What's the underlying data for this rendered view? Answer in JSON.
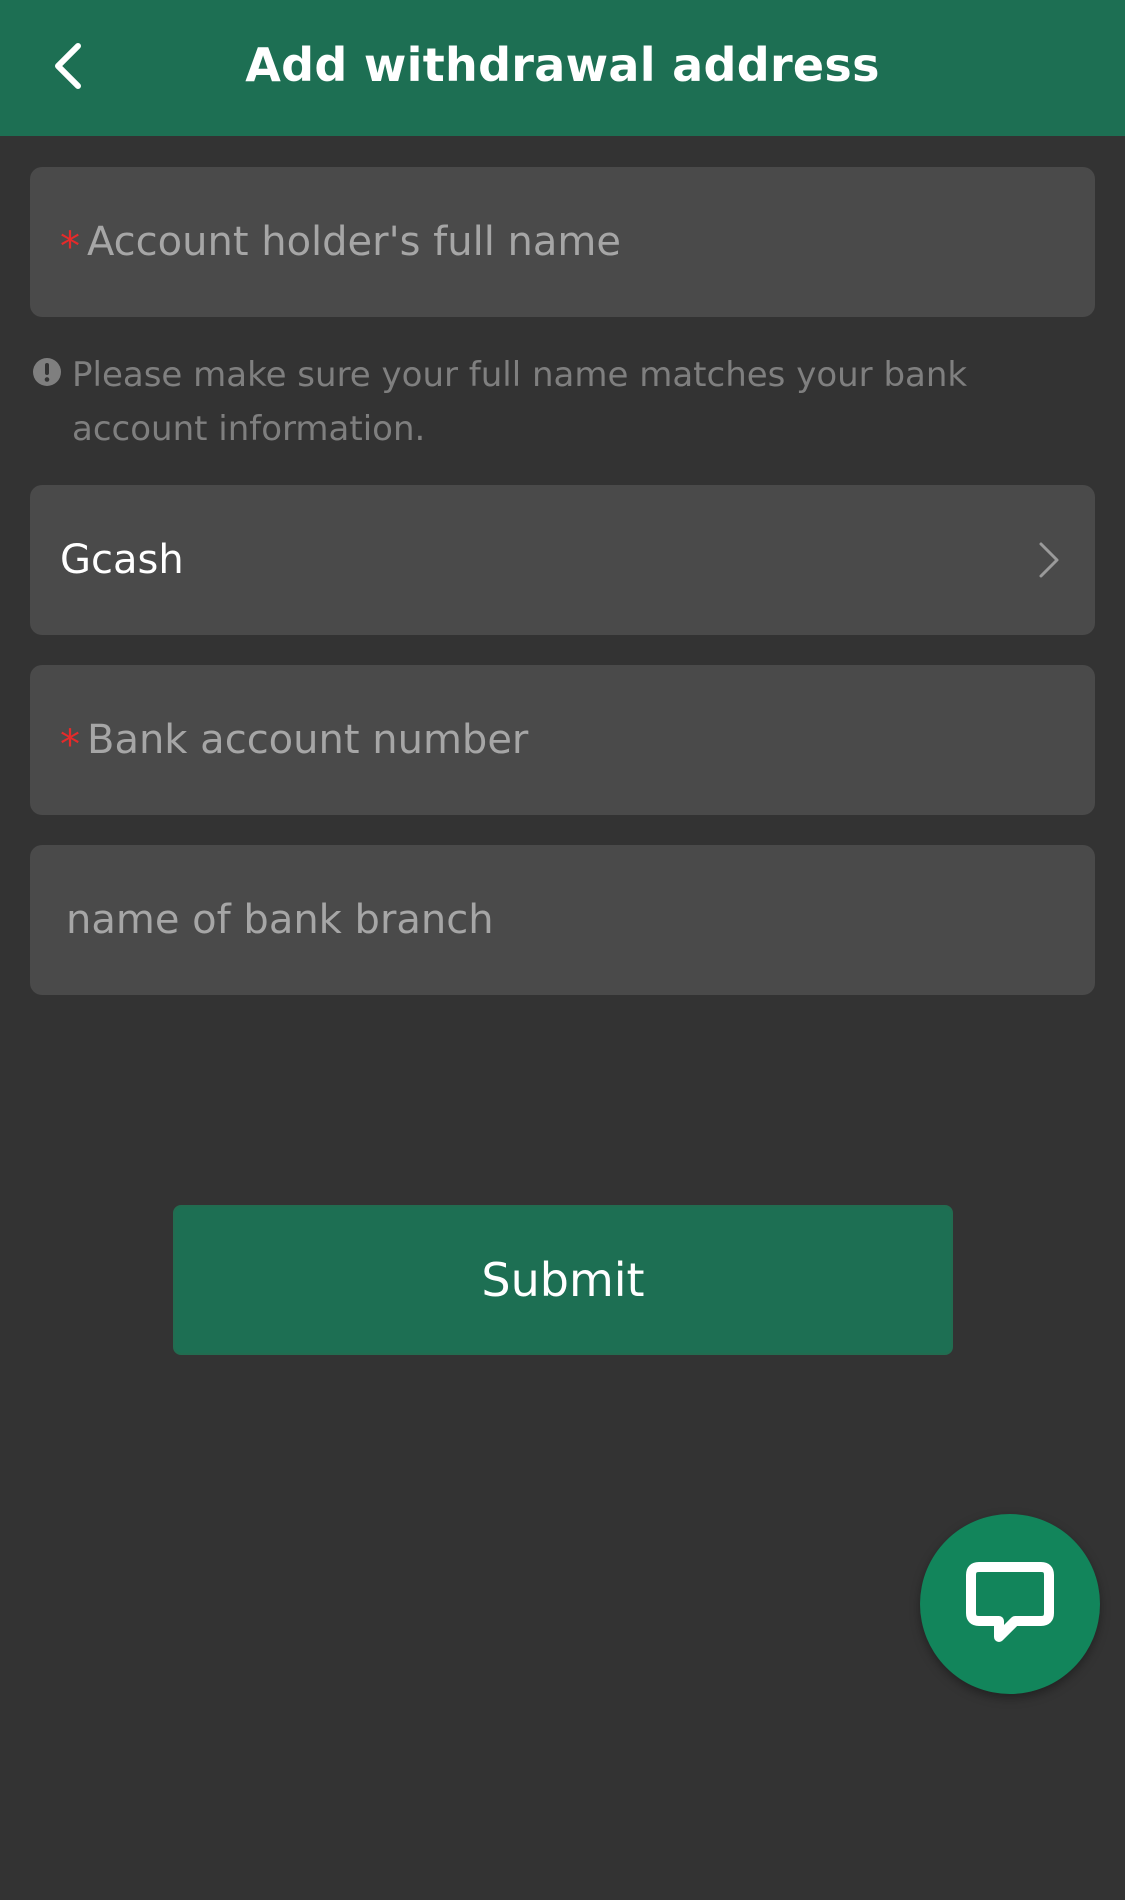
{
  "header": {
    "title": "Add withdrawal address",
    "back_icon": "chevron-left-icon"
  },
  "form": {
    "full_name": {
      "required_mark": "*",
      "placeholder": "Account holder's full name",
      "value": ""
    },
    "name_hint": {
      "icon": "exclamation-circle-icon",
      "text": "Please make sure your full name matches your bank account information."
    },
    "bank_select": {
      "value": "Gcash",
      "icon": "chevron-right-icon"
    },
    "account_number": {
      "required_mark": "*",
      "placeholder": "Bank account number",
      "value": ""
    },
    "branch": {
      "placeholder": "name of bank branch",
      "value": ""
    },
    "submit_label": "Submit"
  },
  "chat": {
    "icon": "chat-bubble-icon"
  },
  "colors": {
    "brand_green": "#1d6f53",
    "fab_green": "#12855b",
    "background": "#333333",
    "field_bg": "#4a4a4a",
    "required_red": "#e52a2a"
  }
}
